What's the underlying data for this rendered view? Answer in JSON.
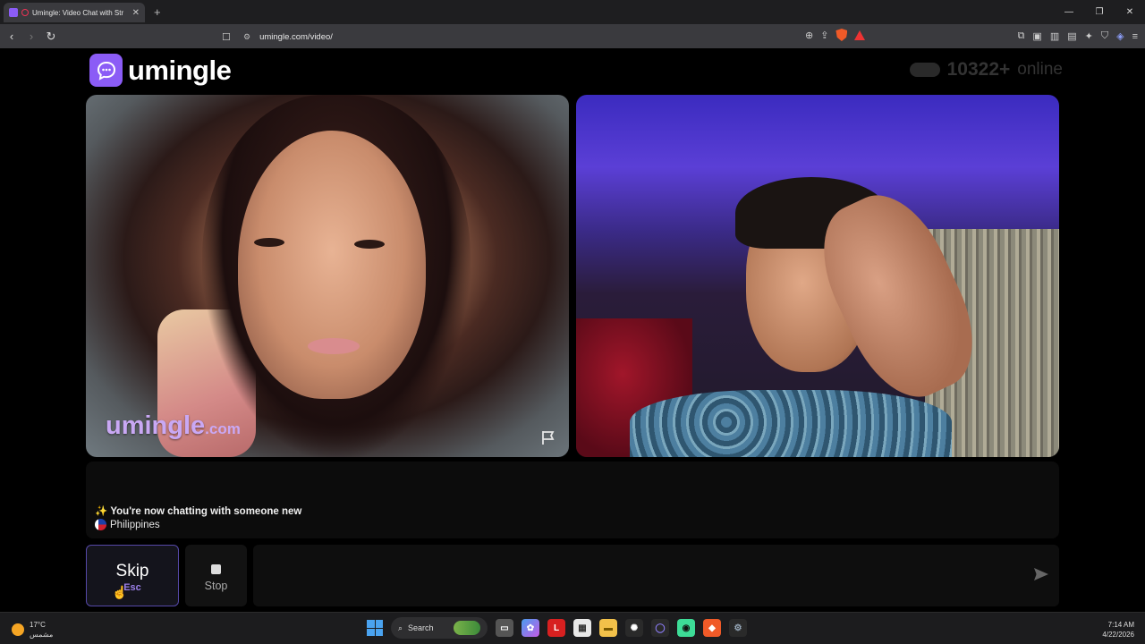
{
  "browser": {
    "tab_title": "Umingle: Video Chat with Str",
    "new_tab": "+",
    "url": "umingle.com/video/",
    "window_controls": [
      "—",
      "❐",
      "✕"
    ]
  },
  "site": {
    "logo_text": "umingle",
    "online_count": "10322+",
    "online_label": "online"
  },
  "videos": {
    "watermark_main": "umingle",
    "watermark_tld": ".com"
  },
  "chat": {
    "sparkle": "✨",
    "new_chat_message": "You're now chatting with someone new",
    "country": "Philippines"
  },
  "controls": {
    "skip_label": "Skip",
    "skip_key": "Esc",
    "stop_label": "Stop"
  },
  "taskbar": {
    "temperature": "17°C",
    "weather_desc": "مشمس",
    "search_label": "Search",
    "time": "7:14 AM",
    "date": "4/22/2026"
  },
  "colors": {
    "brand_purple": "#8b5cf6",
    "skip_border": "#5548a8"
  }
}
